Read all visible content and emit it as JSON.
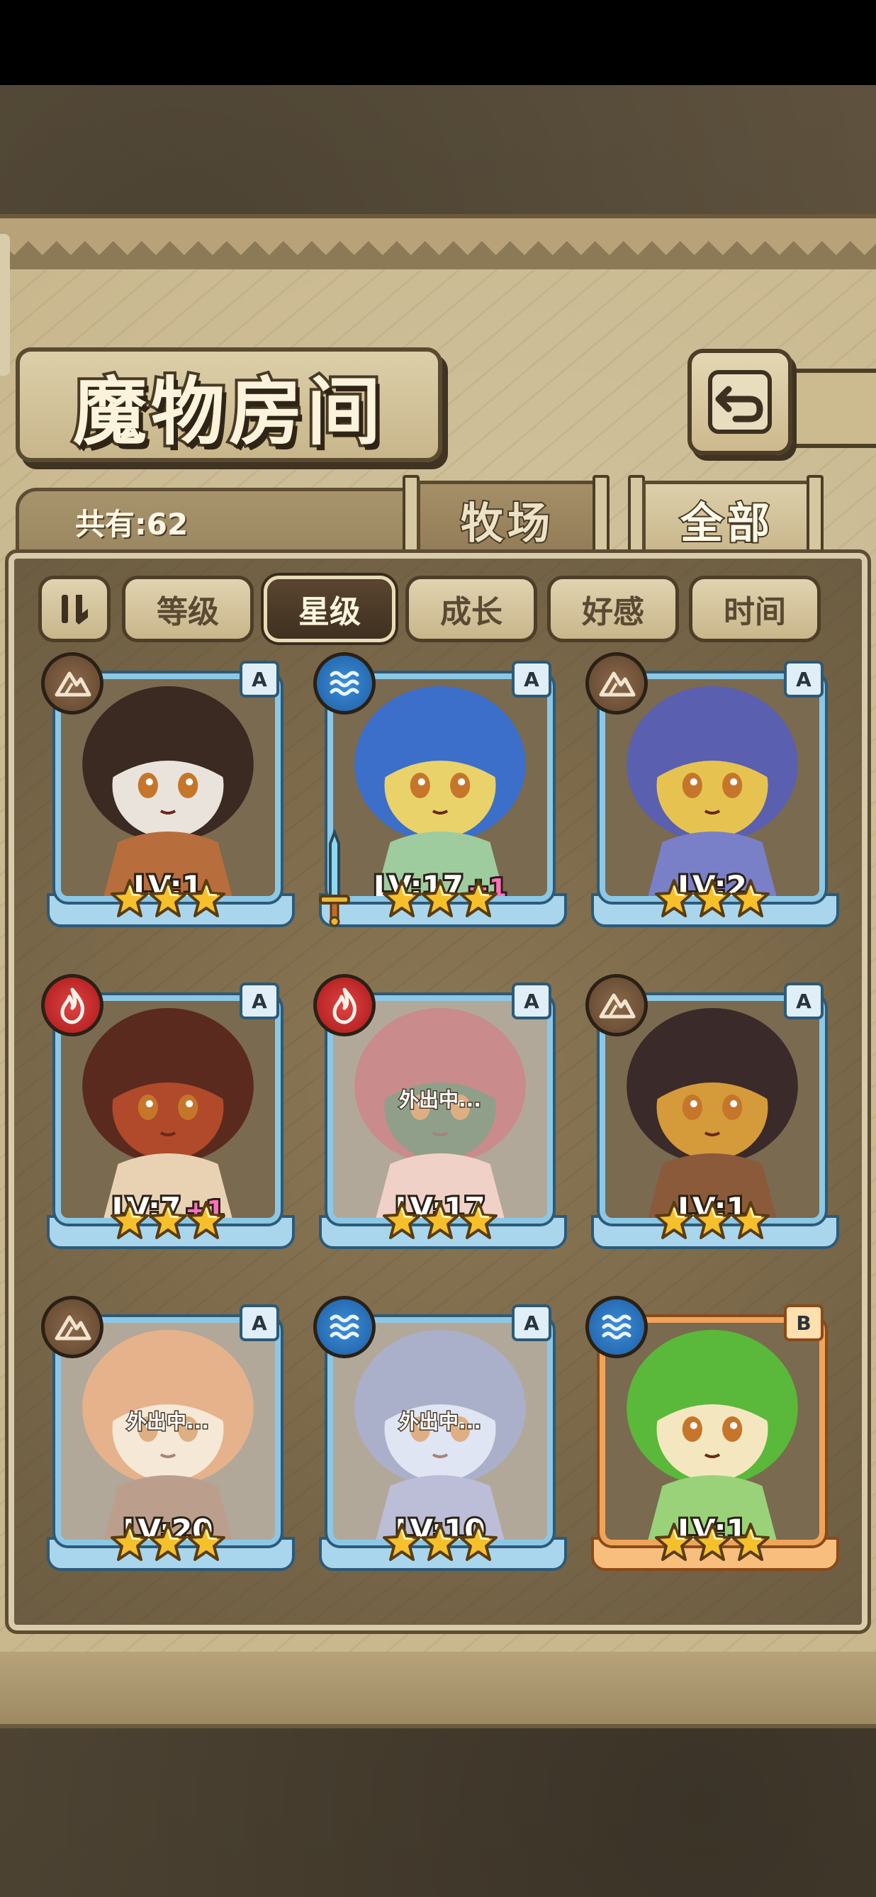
{
  "screen": {
    "title": "魔物房间",
    "count_label": "共有:62",
    "back_icon": "return-arrow-icon"
  },
  "tabs": [
    {
      "label": "牧场",
      "active": false
    },
    {
      "label": "全部",
      "active": true
    }
  ],
  "sort": {
    "toggle_icon": "sort-order-icon",
    "buttons": [
      {
        "label": "等级",
        "active": false
      },
      {
        "label": "星级",
        "active": true
      },
      {
        "label": "成长",
        "active": false
      },
      {
        "label": "好感",
        "active": false
      },
      {
        "label": "时间",
        "active": false
      }
    ]
  },
  "monsters": [
    {
      "element": "earth",
      "grade": "A",
      "level": "LV:1",
      "bonus": "",
      "stars": 3,
      "away": false,
      "frame": "blue",
      "palette": [
        "#3a2a22",
        "#e9e3dc",
        "#b86d3c"
      ]
    },
    {
      "element": "water",
      "grade": "A",
      "level": "LV:17",
      "bonus": "+1",
      "stars": 3,
      "away": false,
      "frame": "blue",
      "weapon": true,
      "palette": [
        "#3c6fc9",
        "#e9d26a",
        "#9fcc9f"
      ]
    },
    {
      "element": "earth",
      "grade": "A",
      "level": "LV:2",
      "bonus": "",
      "stars": 3,
      "away": false,
      "frame": "blue",
      "palette": [
        "#5a5fb0",
        "#e6c350",
        "#7a80c8"
      ]
    },
    {
      "element": "fire",
      "grade": "A",
      "level": "LV:7",
      "bonus": "+1",
      "stars": 3,
      "away": false,
      "frame": "blue",
      "palette": [
        "#5a2a1e",
        "#b04a2a",
        "#e9d2b4"
      ]
    },
    {
      "element": "fire",
      "grade": "A",
      "level": "LV:17",
      "bonus": "",
      "stars": 3,
      "away": true,
      "away_text": "外出中...",
      "frame": "blue",
      "palette": [
        "#a33838",
        "#3e5a36",
        "#e6b0a0"
      ]
    },
    {
      "element": "earth",
      "grade": "A",
      "level": "LV:1",
      "bonus": "",
      "stars": 3,
      "away": false,
      "frame": "blue",
      "palette": [
        "#3a2a2a",
        "#d59a3a",
        "#8a5a3a"
      ]
    },
    {
      "element": "earth",
      "grade": "A",
      "level": "LV:20",
      "bonus": "",
      "stars": 3,
      "away": true,
      "away_text": "外出中...",
      "frame": "blue",
      "palette": [
        "#d27a3a",
        "#f0d8b8",
        "#8a5a3a"
      ]
    },
    {
      "element": "water",
      "grade": "A",
      "level": "LV:10",
      "bonus": "",
      "stars": 3,
      "away": true,
      "away_text": "外出中...",
      "frame": "blue",
      "palette": [
        "#6d78a3",
        "#c9d2e8",
        "#8a8fb8"
      ]
    },
    {
      "element": "water",
      "grade": "B",
      "level": "LV:1",
      "bonus": "",
      "stars": 3,
      "away": false,
      "frame": "orange",
      "palette": [
        "#5ab83a",
        "#f4e7c0",
        "#9ad27a"
      ]
    }
  ]
}
